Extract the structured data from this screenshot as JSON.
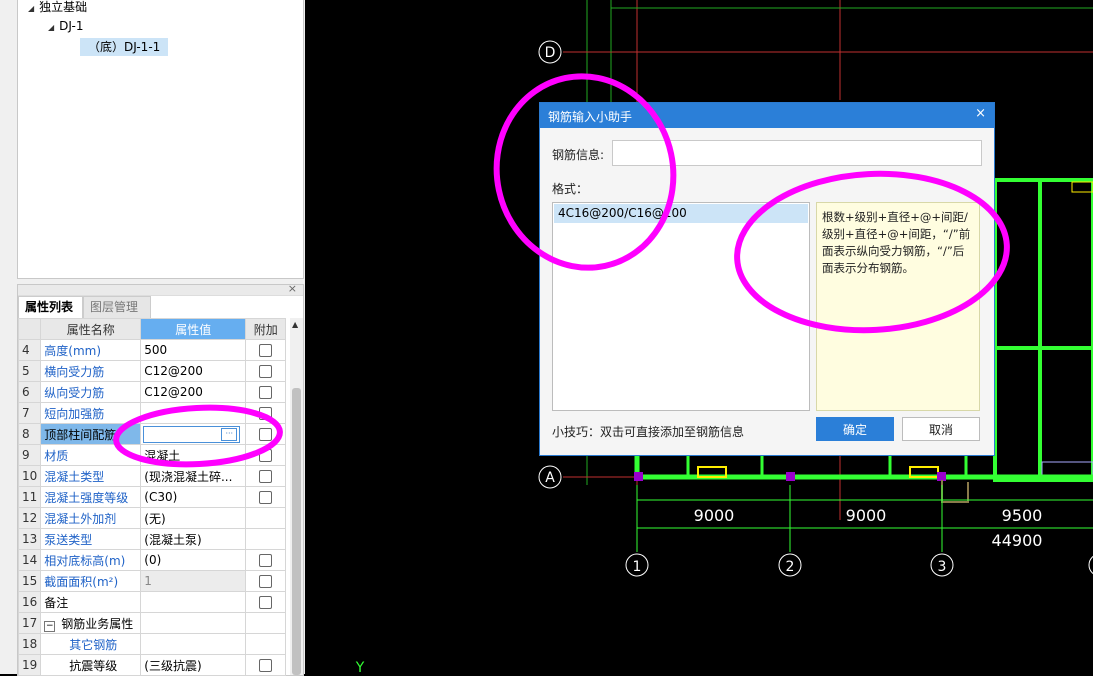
{
  "tree": {
    "root_label": "独立基础",
    "child_label": "DJ-1",
    "leaf_label": "（底）DJ-1-1"
  },
  "props_panel": {
    "close_glyph": "×",
    "tabs": [
      "属性列表",
      "图层管理"
    ],
    "headers": {
      "name": "属性名称",
      "value": "属性值",
      "extra": "附加"
    },
    "rows": [
      {
        "num": "4",
        "name": "高度(mm)",
        "value": "500",
        "blue": true,
        "checkbox": true
      },
      {
        "num": "5",
        "name": "横向受力筋",
        "value": "C12@200",
        "blue": true,
        "checkbox": true
      },
      {
        "num": "6",
        "name": "纵向受力筋",
        "value": "C12@200",
        "blue": true,
        "checkbox": true
      },
      {
        "num": "7",
        "name": "短向加强筋",
        "value": "",
        "blue": true,
        "checkbox": true
      },
      {
        "num": "8",
        "name": "顶部柱间配筋",
        "value": "",
        "blue": false,
        "checkbox": true,
        "editing": true
      },
      {
        "num": "9",
        "name": "材质",
        "value": "混凝土",
        "blue": true,
        "checkbox": true
      },
      {
        "num": "10",
        "name": "混凝土类型",
        "value": "(现浇混凝土碎...",
        "blue": true,
        "checkbox": true
      },
      {
        "num": "11",
        "name": "混凝土强度等级",
        "value": "(C30)",
        "blue": true,
        "checkbox": true
      },
      {
        "num": "12",
        "name": "混凝土外加剂",
        "value": "(无)",
        "blue": true,
        "checkbox": false
      },
      {
        "num": "13",
        "name": "泵送类型",
        "value": "(混凝土泵)",
        "blue": true,
        "checkbox": false
      },
      {
        "num": "14",
        "name": "相对底标高(m)",
        "value": "(0)",
        "blue": true,
        "checkbox": true
      },
      {
        "num": "15",
        "name": "截面面积(m²)",
        "value": "1",
        "blue": true,
        "checkbox": true,
        "gray": true
      },
      {
        "num": "16",
        "name": "备注",
        "value": "",
        "blue": false,
        "checkbox": true
      },
      {
        "num": "17",
        "name": "钢筋业务属性",
        "value": "",
        "blue": false,
        "checkbox": false,
        "group": true
      },
      {
        "num": "18",
        "name": "其它钢筋",
        "value": "",
        "blue": true,
        "checkbox": false,
        "indent": true
      },
      {
        "num": "19",
        "name": "抗震等级",
        "value": "(三级抗震)",
        "blue": false,
        "checkbox": true,
        "indent": true
      }
    ]
  },
  "cad": {
    "axis_labels": {
      "d": "D",
      "a": "A",
      "n1": "1",
      "n2": "2",
      "n3": "3"
    },
    "dims": {
      "d1": "9000",
      "d2": "9000",
      "d3": "9500",
      "total": "44900"
    },
    "y_axis_label": "Y"
  },
  "dialog": {
    "title": "钢筋输入小助手",
    "close_glyph": "×",
    "rebar_label": "钢筋信息:",
    "rebar_value": "",
    "format_label": "格式：",
    "format_item": "4C16@200/C16@100",
    "help_text": "根数+级别+直径+@+间距/级别+直径+@+间距，“/”前面表示纵向受力钢筋，“/”后面表示分布钢筋。",
    "tip": "小技巧：双击可直接添加至钢筋信息",
    "ok": "确定",
    "cancel": "取消"
  },
  "colors": {
    "annotation": "#ff00ff",
    "dialog_accent": "#2b7fd8",
    "beam_green": "#33ff33"
  }
}
